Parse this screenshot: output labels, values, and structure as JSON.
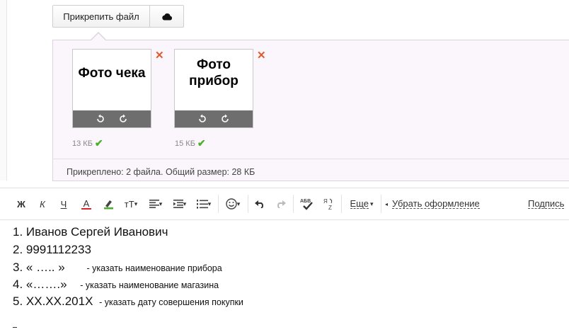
{
  "attach": {
    "button_label": "Прикрепить файл",
    "cloud_icon": "cloud-icon"
  },
  "files": [
    {
      "thumb_text": "Фото чека",
      "size": "13 КБ"
    },
    {
      "thumb_text": "Фото\nприбор",
      "size": "15 КБ"
    }
  ],
  "summary": "Прикреплено: 2 файла. Общий размер: 28 КБ",
  "toolbar": {
    "bold": "Ж",
    "italic": "К",
    "underline": "Ч",
    "text_color": "А",
    "font_size": "тТ",
    "more_label": "Еще",
    "clear_format_label": "Убрать оформление",
    "signature_label": "Подпись"
  },
  "body": {
    "lines": [
      {
        "main": "1. Иванов Сергей Иванович",
        "note": ""
      },
      {
        "main": "2. 9991112233",
        "note": ""
      },
      {
        "main": "3. « ….. »",
        "note": "- указать наименование прибора"
      },
      {
        "main": "4. «…….»",
        "note": "- указать наименование магазина"
      },
      {
        "main": "5. XX.XX.201X",
        "note": "- указать дату совершения покупки"
      }
    ]
  },
  "colors": {
    "panel_bg": "#faf6fb",
    "remove_x": "#e05a2b",
    "check": "#4caf2a",
    "thumb_bar": "#6e6e6e"
  }
}
